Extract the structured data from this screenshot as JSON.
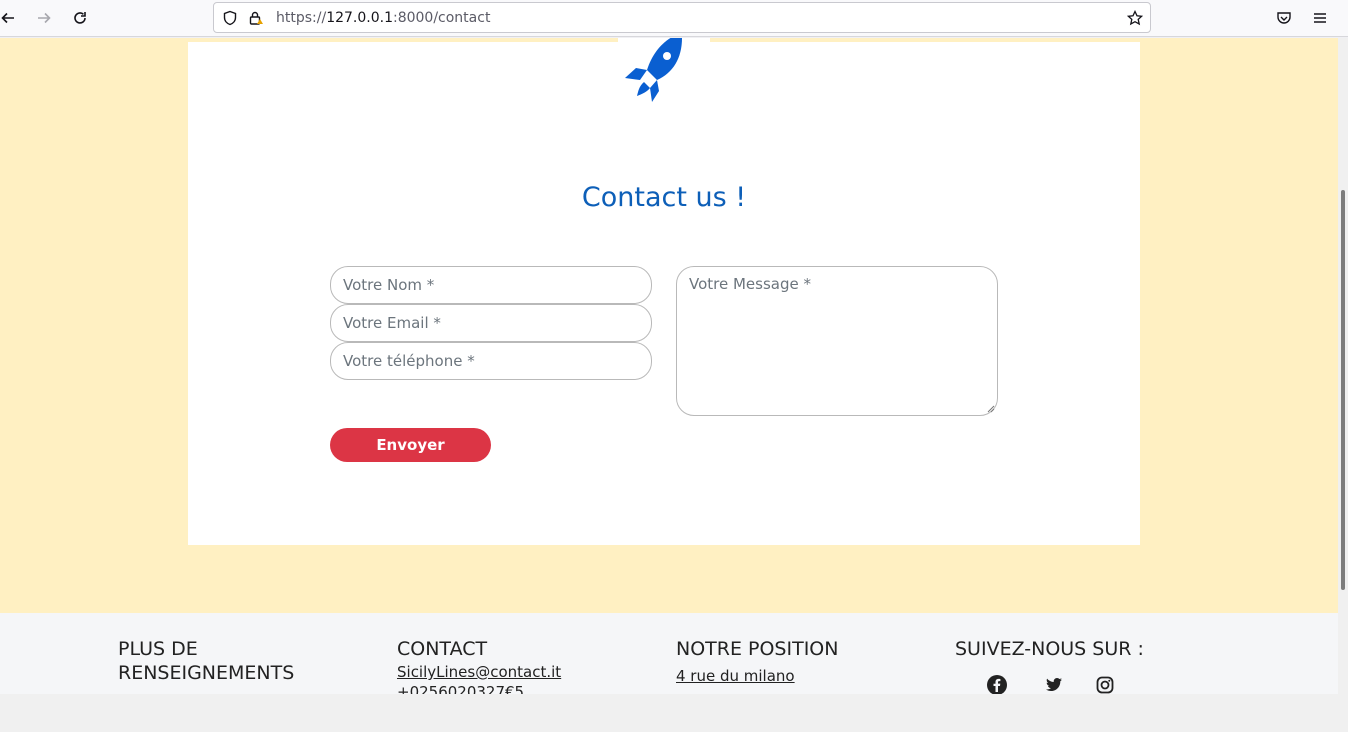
{
  "browser": {
    "url_scheme": "https://",
    "url_host": "127.0.0.1",
    "url_rest": ":8000/contact"
  },
  "page": {
    "title": "Contact us !",
    "form": {
      "name_placeholder": "Votre Nom *",
      "email_placeholder": "Votre Email *",
      "phone_placeholder": "Votre téléphone *",
      "message_placeholder": "Votre Message *",
      "submit_label": "Envoyer"
    }
  },
  "footer": {
    "info_heading_line1": "PLUS DE",
    "info_heading_line2": "RENSEIGNEMENTS",
    "contact_heading": "CONTACT",
    "contact_email": "SicilyLines@contact.it",
    "contact_phone": "+0256020327€5",
    "position_heading": "NOTRE POSITION",
    "position_address": "4 rue du milano",
    "social_heading": "SUIVEZ-NOUS SUR :"
  },
  "colors": {
    "page_background": "#fff0c2",
    "title_blue": "#0d5fb8",
    "submit_red": "#dc3545"
  },
  "icons": [
    "back-arrow-icon",
    "forward-arrow-icon",
    "reload-icon",
    "shield-icon",
    "insecure-lock-icon",
    "bookmark-star-icon",
    "pocket-icon",
    "menu-icon",
    "rocket-icon",
    "facebook-icon",
    "twitter-icon",
    "instagram-icon"
  ]
}
